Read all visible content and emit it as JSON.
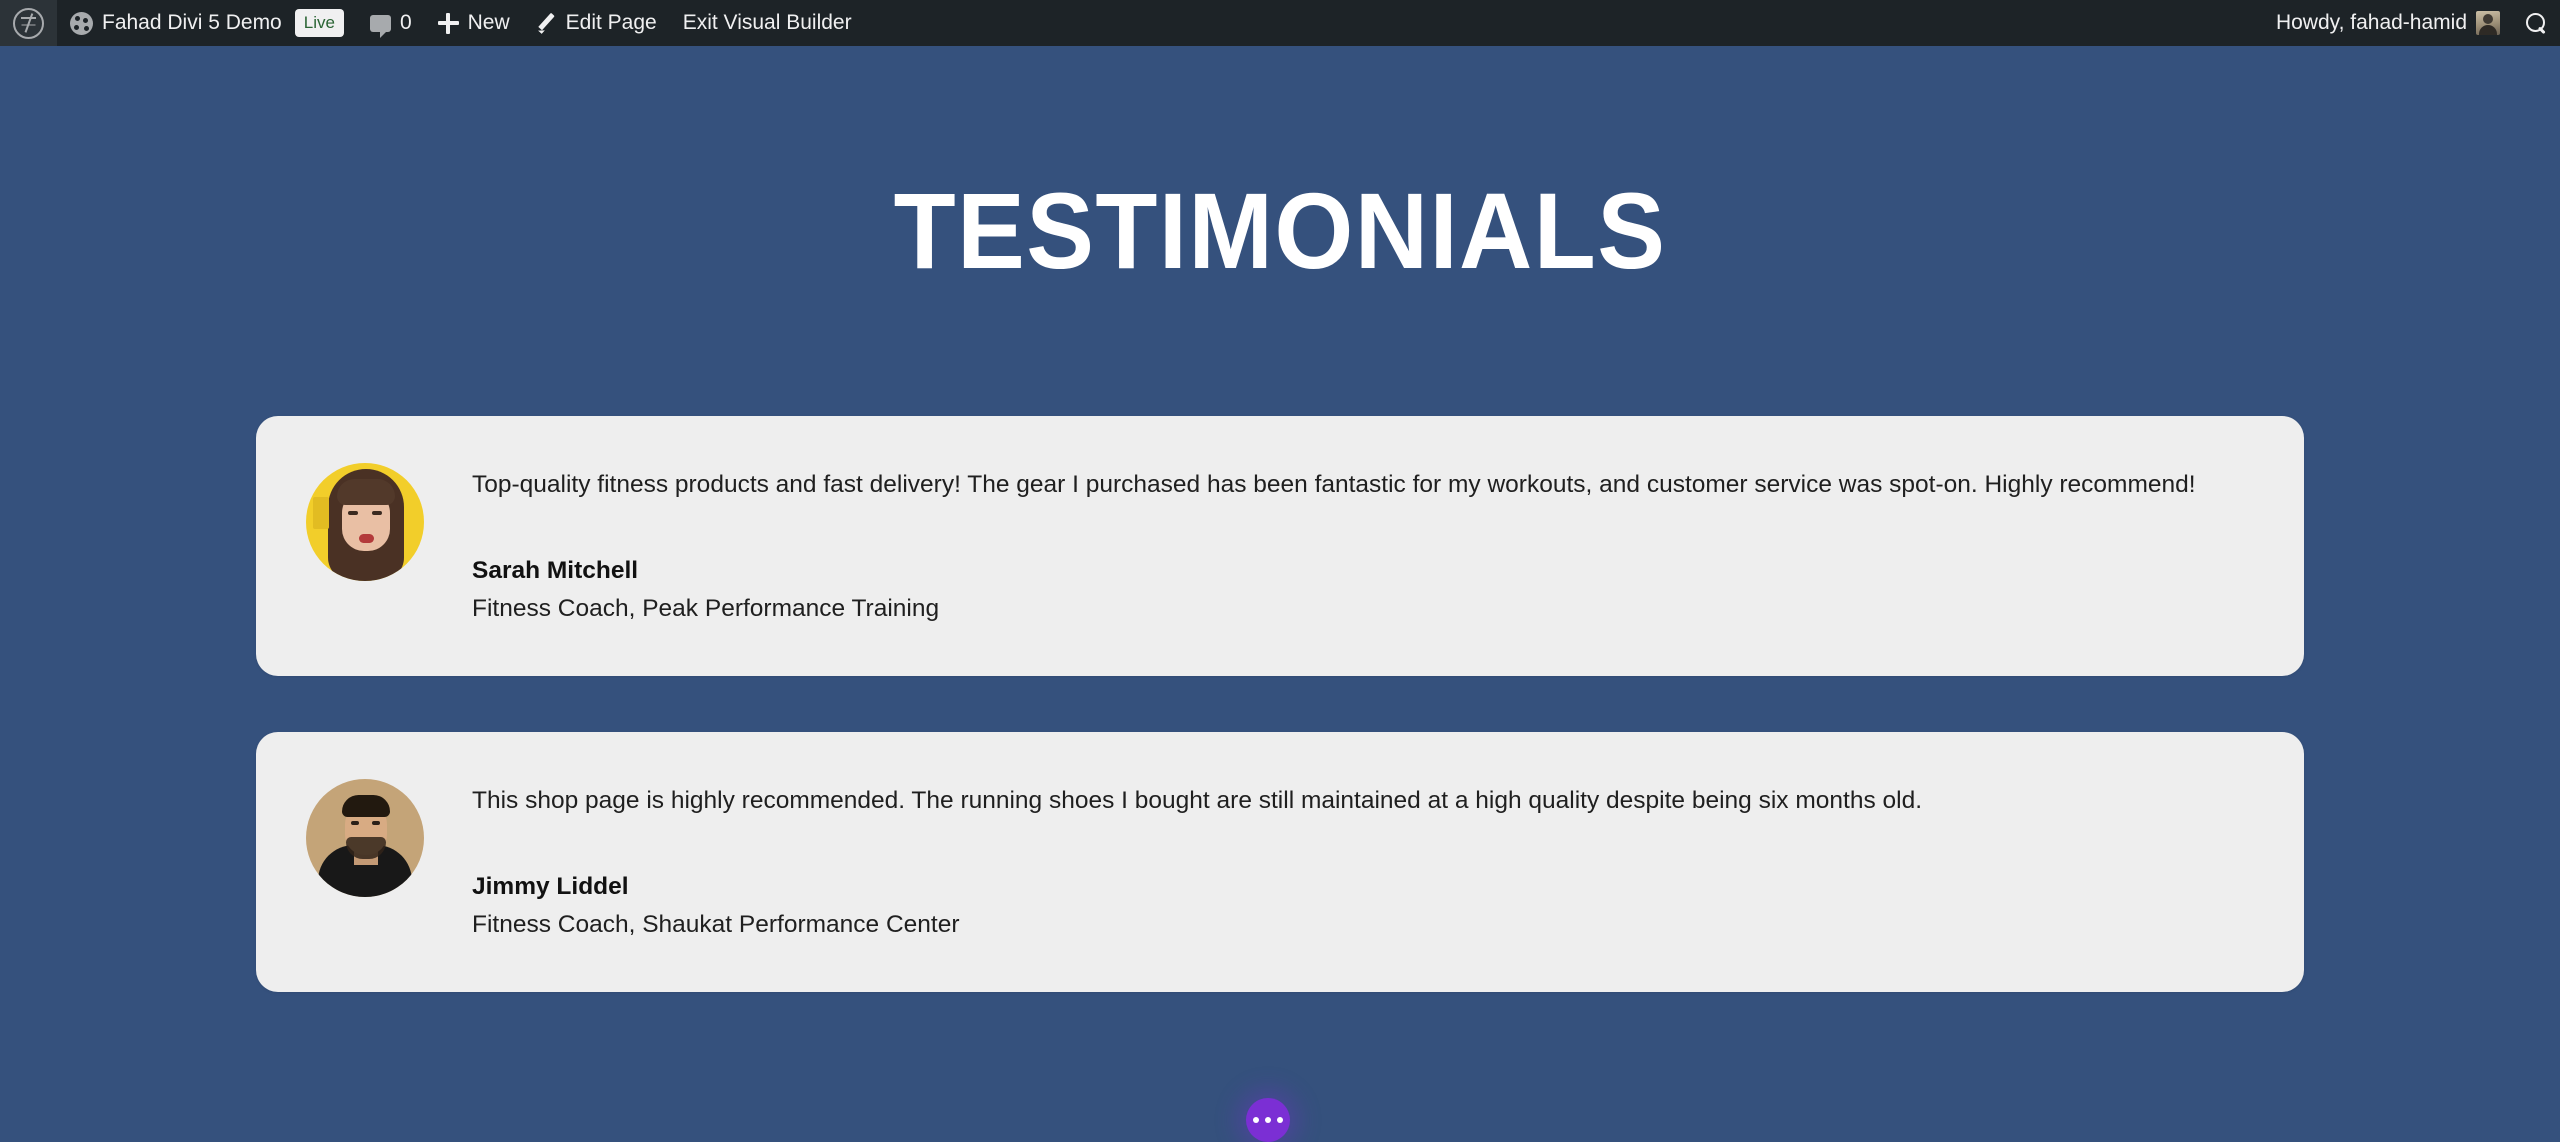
{
  "admin_bar": {
    "wp_logo_icon": "wordpress-logo-icon",
    "site_icon": "site-dashboard-icon",
    "site_name": "Fahad Divi 5 Demo",
    "live_badge": "Live",
    "comment_icon": "comment-bubble-icon",
    "comment_count": "0",
    "plus_icon": "plus-icon",
    "new_label": "New",
    "pencil_icon": "pencil-icon",
    "edit_page_label": "Edit Page",
    "exit_builder_label": "Exit Visual Builder",
    "howdy": "Howdy, fahad-hamid",
    "avatar_icon": "user-avatar-icon",
    "search_icon": "search-icon"
  },
  "page": {
    "title": "TESTIMONIALS",
    "background_color": "#35517d",
    "card_background_color": "#eeeeee"
  },
  "testimonials": [
    {
      "avatar_icon": "avatar-sarah-mitchell",
      "quote": "Top-quality fitness products and fast delivery! The gear I purchased has been fantastic for my workouts, and customer service was spot-on. Highly recommend!",
      "name": "Sarah Mitchell",
      "role": "Fitness Coach, Peak Performance Training"
    },
    {
      "avatar_icon": "avatar-jimmy-liddel",
      "quote": "This shop page is highly recommended. The running shoes I bought are still maintained at a high quality despite being six months old.",
      "name": "Jimmy Liddel",
      "role": "Fitness Coach, Shaukat Performance Center"
    }
  ],
  "floating_button": {
    "icon": "ellipsis-icon",
    "color": "#7b2fd4"
  }
}
